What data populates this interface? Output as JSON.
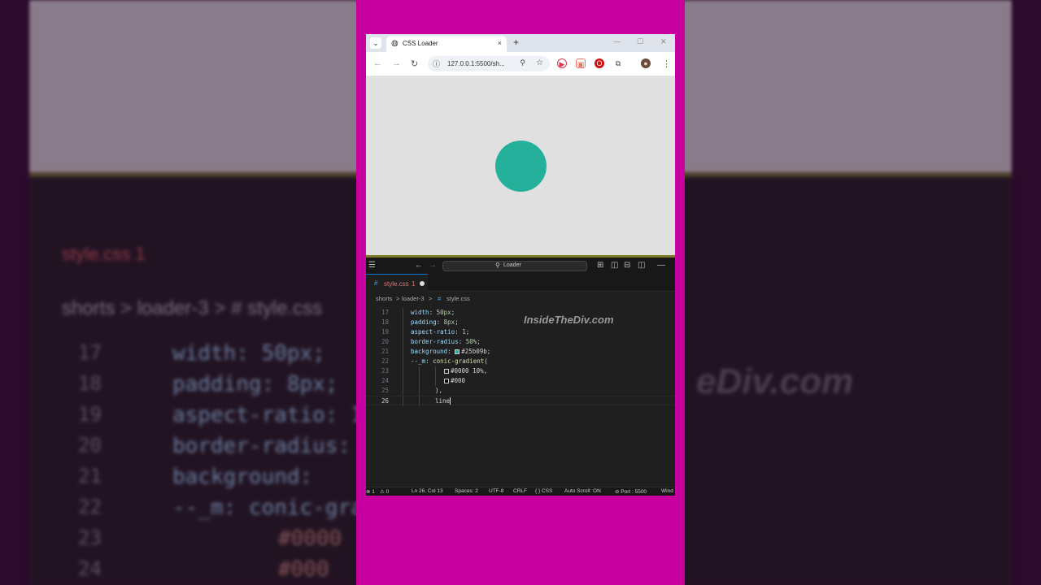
{
  "background_blur": {
    "tab_name": "style.css",
    "tab_count": "1",
    "breadcrumb": "shorts  >  loader-3  >  #  style.css",
    "code_lines": [
      "width: 50px;",
      "padding: 8px;",
      "aspect-ratio: 1",
      "border-radius:",
      "background:",
      "--_m: conic-gra",
      "#0000",
      "#000"
    ],
    "line_numbers": [
      "17",
      "18",
      "19",
      "20",
      "21",
      "22",
      "23",
      "24"
    ],
    "watermark": "eDiv.com"
  },
  "browser": {
    "tab_title": "CSS Loader",
    "url": "127.0.0.1:5500/sh...",
    "new_tab": "+",
    "close": "×",
    "win_min": "—",
    "win_max": "☐",
    "win_close": "✕",
    "icons": {
      "back": "←",
      "forward": "→",
      "reload": "↻",
      "info": "ⓘ",
      "zoom": "⚲",
      "star": "☆",
      "tab_menu": "⌄",
      "menu": "⋮"
    },
    "loader": {
      "color": "#25b09b"
    }
  },
  "vscode": {
    "search_text": "Loader",
    "search_icon": "⚲",
    "tab": {
      "hash": "#",
      "name": "style.css",
      "count": "1"
    },
    "breadcrumb": {
      "folder1": "shorts",
      "folder2": "loader-3",
      "hash": "#",
      "file": "style.css",
      "sep": ">"
    },
    "watermark": "InsideTheDiv.com",
    "lines": [
      {
        "n": "17",
        "prop": "width",
        "value": "50px"
      },
      {
        "n": "18",
        "prop": "padding",
        "value": "8px"
      },
      {
        "n": "19",
        "prop": "aspect-ratio",
        "value": "1"
      },
      {
        "n": "20",
        "prop": "border-radius",
        "value": "50%"
      },
      {
        "n": "21",
        "prop": "background",
        "value": "#25b09b"
      },
      {
        "n": "22",
        "prop": "--_m",
        "value": "conic-gradient("
      },
      {
        "n": "23",
        "value": "#0000 10%,"
      },
      {
        "n": "24",
        "value": "#000"
      },
      {
        "n": "25",
        "value": "),"
      },
      {
        "n": "26",
        "value": "line"
      }
    ],
    "status": {
      "errors": "⊗ 1",
      "warnings": "⚠ 0",
      "position": "Ln 26, Col 13",
      "spaces": "Spaces: 2",
      "encoding": "UTF-8",
      "eol": "CRLF",
      "language": "{ } CSS",
      "autoscroll": "Auto Scroll: ON",
      "port": "⊘ Port : 5500",
      "wind": "Wind"
    }
  }
}
